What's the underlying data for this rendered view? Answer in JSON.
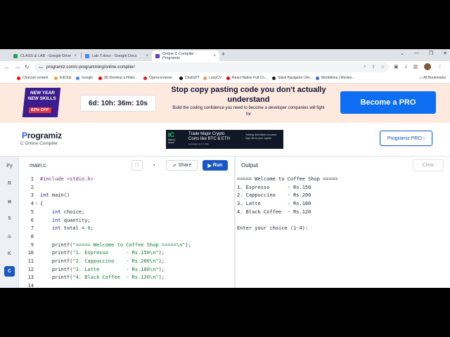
{
  "browser": {
    "tabs": [
      {
        "title": "CLASS & LAB - Google Drive",
        "favicon_color": "#1fa463"
      },
      {
        "title": "Lab 7.docx - Google Docs",
        "favicon_color": "#4285f4"
      },
      {
        "title": "Online C Compiler - Programiz",
        "favicon_color": "#5b3fd1"
      }
    ],
    "new_tab_label": "+",
    "url": "programiz.com/c-programming/online-compiler/",
    "bookmarks": [
      {
        "label": "Channel content",
        "color": "#ff0000"
      },
      {
        "label": "EdClub",
        "color": "#f4a23c"
      },
      {
        "label": "Google",
        "color": "#4285f4"
      },
      {
        "label": "(8) Develop a Hotel...",
        "color": "#ff0000"
      },
      {
        "label": "Opera browser",
        "color": "#e21c23"
      },
      {
        "label": "ChatGPT",
        "color": "#111111"
      },
      {
        "label": "LoopCV",
        "color": "#f2994a"
      },
      {
        "label": "React Native Full Co...",
        "color": "#ff0000"
      },
      {
        "label": "Stack Navigator | Re...",
        "color": "#1d1d1d"
      },
      {
        "label": "Mediafone | Movies...",
        "color": "#2b6cd4"
      }
    ],
    "all_bookmarks": "All Bookmarks"
  },
  "promo": {
    "badge_line1": "NEW YEAR",
    "badge_line2": "NEW SKILLS",
    "badge_discount": "62% OFF",
    "timer": "6d: 10h: 36m: 10s",
    "title": "Stop copy pasting code you don't actually understand",
    "subtitle": "Build the coding confidence you need to become a developer companies will fight for",
    "cta": "Become a PRO"
  },
  "header": {
    "logo_p": "P",
    "logo_rest": "rogramiz",
    "subtitle": "C Online Compiler",
    "ad": {
      "brand_ic": "IC",
      "brand_sub1": "Markets",
      "brand_sub2": "Global",
      "line1": "Trade Major Crypto",
      "line2": "Coins like BTC & ETH",
      "line3": "Leverage up to 1:200",
      "side": "Trading derivatives involves high risk to your capital"
    },
    "pro_button": "Programiz PRO ›"
  },
  "editor": {
    "filename": "main.c",
    "share_label": "Share",
    "run_label": "Run",
    "code": [
      {
        "n": "1",
        "parts": [
          {
            "t": "#include <stdio.h>",
            "c": "inc"
          }
        ]
      },
      {
        "n": "2",
        "parts": []
      },
      {
        "n": "3",
        "parts": [
          {
            "t": "int",
            "c": "kw"
          },
          {
            "t": " main()",
            "c": ""
          }
        ]
      },
      {
        "n": "4",
        "fold": true,
        "parts": [
          {
            "t": "{",
            "c": ""
          }
        ]
      },
      {
        "n": "5",
        "parts": [
          {
            "t": "    ",
            "c": ""
          },
          {
            "t": "int",
            "c": "kw"
          },
          {
            "t": " choice;",
            "c": ""
          }
        ]
      },
      {
        "n": "6",
        "parts": [
          {
            "t": "    ",
            "c": ""
          },
          {
            "t": "int",
            "c": "kw"
          },
          {
            "t": " quantity;",
            "c": ""
          }
        ]
      },
      {
        "n": "7",
        "parts": [
          {
            "t": "    ",
            "c": ""
          },
          {
            "t": "int",
            "c": "kw"
          },
          {
            "t": " total = ",
            "c": ""
          },
          {
            "t": "0",
            "c": "num"
          },
          {
            "t": ";",
            "c": ""
          }
        ]
      },
      {
        "n": "8",
        "parts": []
      },
      {
        "n": "9",
        "parts": [
          {
            "t": "    printf(",
            "c": ""
          },
          {
            "t": "\"===== Welcome to Coffee Shop =====\\n\"",
            "c": "str"
          },
          {
            "t": ");",
            "c": ""
          }
        ]
      },
      {
        "n": "10",
        "parts": [
          {
            "t": "    printf(",
            "c": ""
          },
          {
            "t": "\"1. Espresso      - Rs.150\\n\"",
            "c": "str"
          },
          {
            "t": ");",
            "c": ""
          }
        ]
      },
      {
        "n": "11",
        "parts": [
          {
            "t": "    printf(",
            "c": ""
          },
          {
            "t": "\"2. Cappuccino    - Rs.200\\n\"",
            "c": "str"
          },
          {
            "t": ");",
            "c": ""
          }
        ]
      },
      {
        "n": "12",
        "parts": [
          {
            "t": "    printf(",
            "c": ""
          },
          {
            "t": "\"3. Latte         - Rs.180\\n\"",
            "c": "str"
          },
          {
            "t": ");",
            "c": ""
          }
        ]
      },
      {
        "n": "13",
        "parts": [
          {
            "t": "    printf(",
            "c": ""
          },
          {
            "t": "\"4. Black Coffee  - Rs.120\\n\"",
            "c": "str"
          },
          {
            "t": ");",
            "c": ""
          }
        ]
      },
      {
        "n": "14",
        "parts": []
      }
    ]
  },
  "output": {
    "label": "Output",
    "clear_label": "Clear",
    "lines": [
      "===== Welcome to Coffee Shop =====",
      "1. Espresso      - Rs.150",
      "2. Cappuccino    - Rs.200",
      "3. Latte         - Rs.180",
      "4. Black Coffee  - Rs.120",
      "",
      "Enter your choice (1-4):"
    ]
  },
  "sidebar_icons": [
    "python-icon",
    "r-icon",
    "sql-icon",
    "html-icon",
    "java-icon",
    "kotlin-icon",
    "c-icon"
  ],
  "colors": {
    "accent": "#1a57c2",
    "promo_bg": "#fde9dd",
    "cta": "#0d6ef1"
  }
}
